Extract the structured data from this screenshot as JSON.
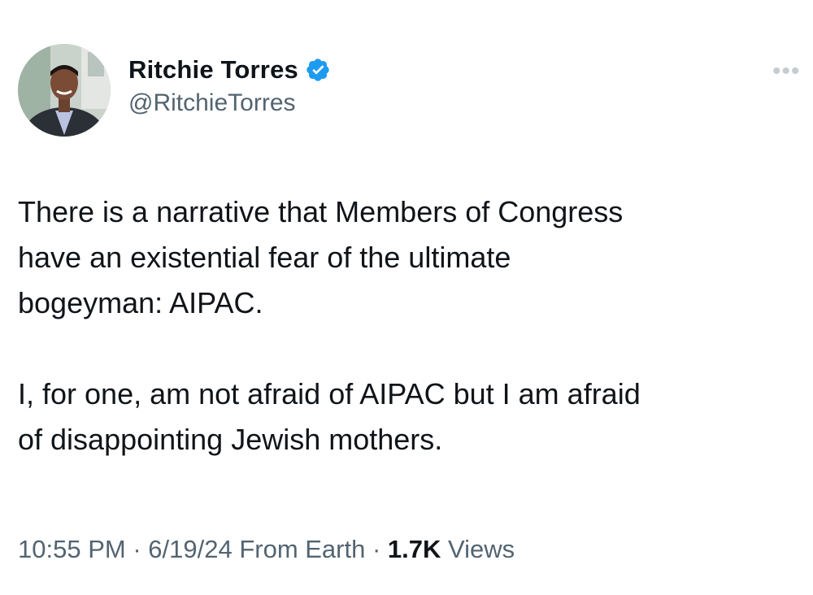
{
  "author": {
    "display_name": "Ritchie Torres",
    "handle": "@RitchieTorres",
    "verified_icon": "verified-badge-icon",
    "avatar_icon": "profile-photo"
  },
  "menu": {
    "more_label": "•••"
  },
  "tweet": {
    "paragraphs": [
      "There is a narrative that Members of Congress\nhave an existential fear of the ultimate\nbogeyman: AIPAC.",
      "I, for one, am not afraid of AIPAC but I am afraid\nof disappointing Jewish mothers."
    ]
  },
  "meta": {
    "time": "10:55 PM",
    "separator1": " · ",
    "date": "6/19/24",
    "source": " From Earth",
    "separator2": " · ",
    "views_count": "1.7K",
    "views_label": " Views"
  },
  "colors": {
    "verified_blue": "#1d9bf0",
    "text_primary": "#0f1419",
    "text_secondary": "#536471"
  }
}
